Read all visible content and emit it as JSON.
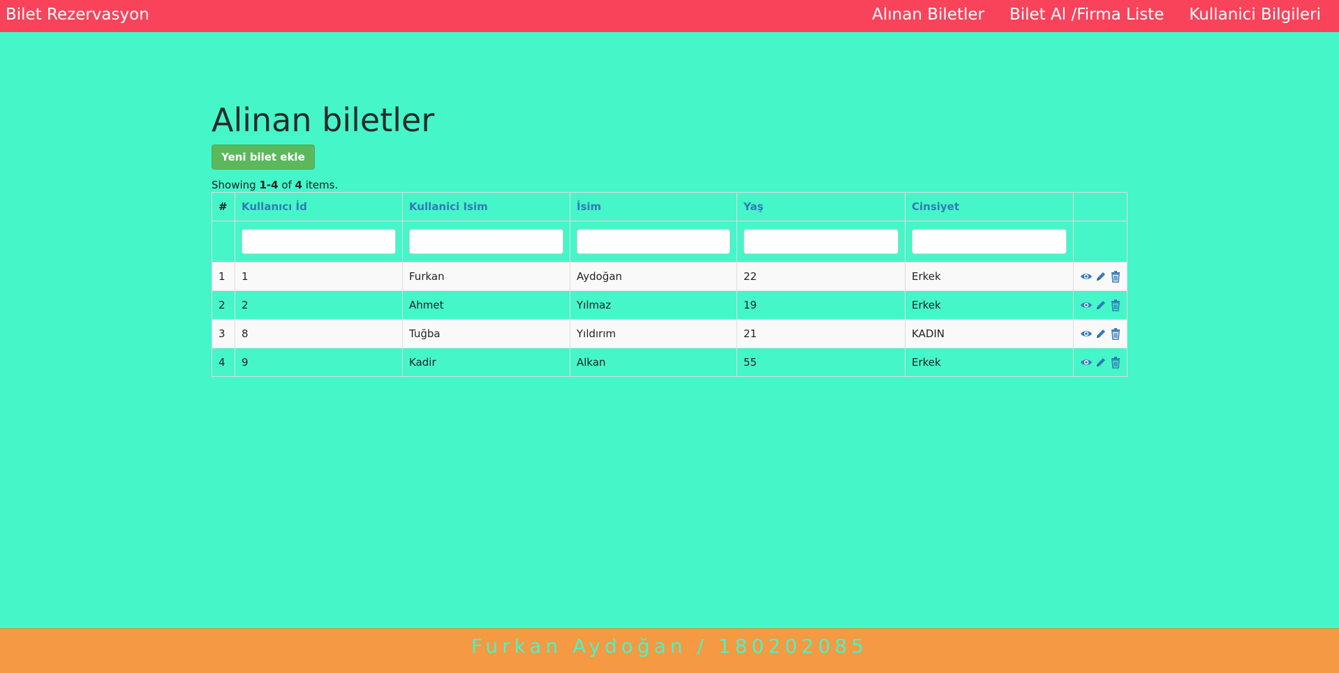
{
  "navbar": {
    "brand": "Bilet Rezervasyon",
    "links": [
      "Alınan Biletler",
      "Bilet Al /Firma Liste",
      "Kullanici Bilgileri"
    ]
  },
  "page": {
    "title": "Alinan biletler",
    "add_button": "Yeni bilet ekle",
    "summary": {
      "prefix": "Showing ",
      "range": "1-4",
      "middle": " of ",
      "total": "4",
      "suffix": " items."
    }
  },
  "table": {
    "columns": [
      "#",
      "Kullanıcı İd",
      "Kullanici Isim",
      "İsim",
      "Yaş",
      "Cinsiyet"
    ],
    "rows": [
      {
        "n": "1",
        "id": "1",
        "kullanici_isim": "Furkan",
        "isim": "Aydoğan",
        "yas": "22",
        "cinsiyet": "Erkek"
      },
      {
        "n": "2",
        "id": "2",
        "kullanici_isim": "Ahmet",
        "isim": "Yılmaz",
        "yas": "19",
        "cinsiyet": "Erkek"
      },
      {
        "n": "3",
        "id": "8",
        "kullanici_isim": "Tuğba",
        "isim": "Yıldırım",
        "yas": "21",
        "cinsiyet": "KADIN"
      },
      {
        "n": "4",
        "id": "9",
        "kullanici_isim": "Kadir",
        "isim": "Alkan",
        "yas": "55",
        "cinsiyet": "Erkek"
      }
    ],
    "row_actions": [
      "eye-icon",
      "pencil-icon",
      "trash-icon"
    ]
  },
  "footer": {
    "text": "Furkan Aydoğan / 180202085"
  },
  "colors": {
    "background": "#45f6c9",
    "navbar": "#f9435a",
    "footer": "#f59942",
    "link": "#337ab7",
    "button": "#5cb85c"
  }
}
